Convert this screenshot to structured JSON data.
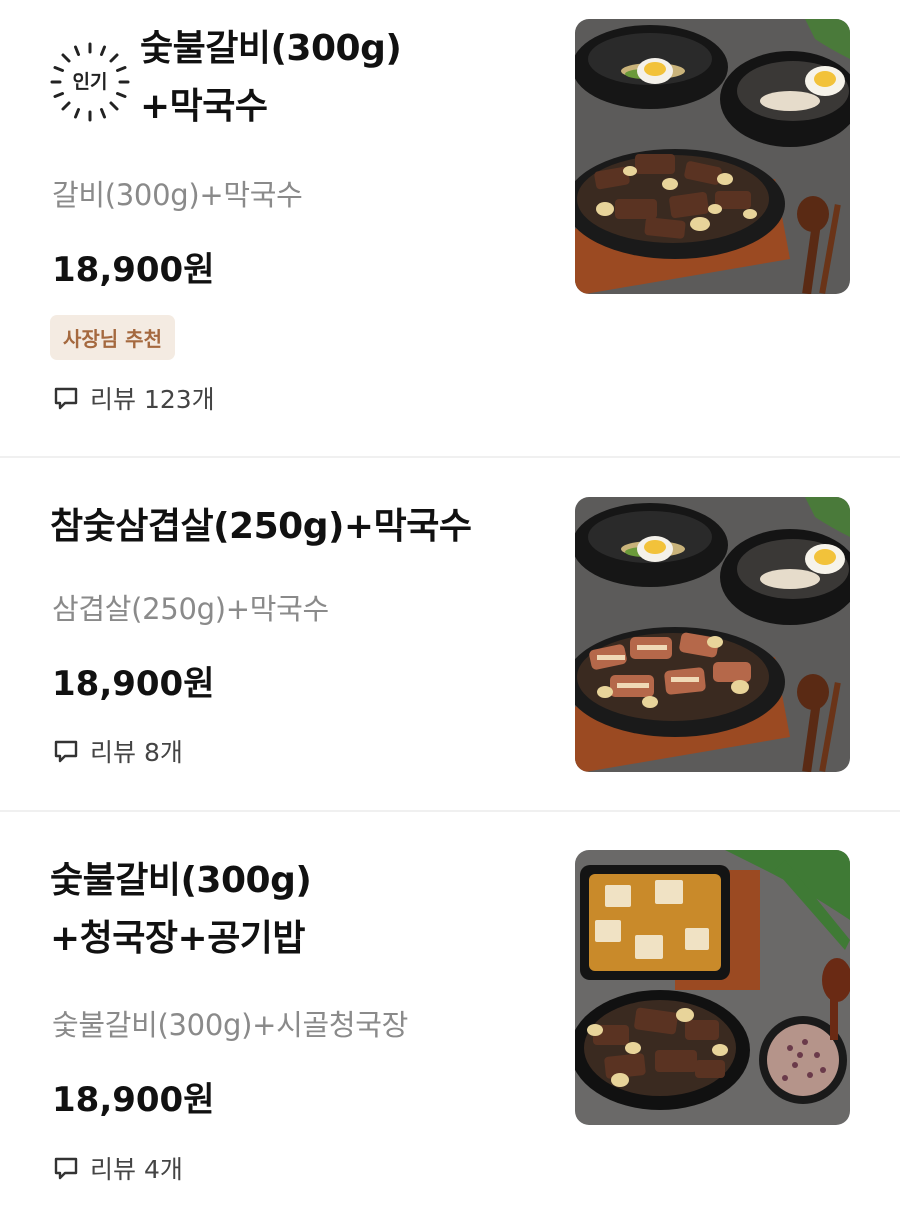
{
  "items": [
    {
      "badge_popular": "인기",
      "title_lines": [
        "숯불갈비(300g)",
        "+막국수"
      ],
      "description": "갈비(300g)+막국수",
      "price": "18,900원",
      "tag": "사장님 추천",
      "review": "리뷰 123개",
      "image_icon": "galbi-makguksu-photo"
    },
    {
      "title_lines": [
        "참숯삼겹살(250g)+막국수"
      ],
      "description": "삼겹살(250g)+막국수",
      "price": "18,900원",
      "review": "리뷰 8개",
      "image_icon": "samgyeopsal-makguksu-photo"
    },
    {
      "title_lines": [
        "숯불갈비(300g)",
        "+청국장+공기밥"
      ],
      "description": "숯불갈비(300g)+시골청국장",
      "price": "18,900원",
      "review": "리뷰 4개",
      "image_icon": "galbi-cheonggukjang-photo"
    }
  ],
  "colors": {
    "tag_bg": "#f4ebe2",
    "tag_text": "#a5693f",
    "muted_text": "#8a8a8a",
    "divider": "#f0f0f0"
  }
}
